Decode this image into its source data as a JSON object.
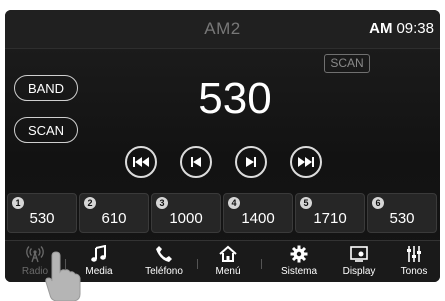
{
  "topbar": {
    "station": "AM2",
    "band": "AM",
    "time": "09:38"
  },
  "scan_indicator": "SCAN",
  "buttons": {
    "band": "BAND",
    "scan": "SCAN"
  },
  "frequency": "530",
  "controls": [
    "seek-back",
    "tune-down",
    "tune-up",
    "seek-forward"
  ],
  "presets": [
    {
      "num": "1",
      "value": "530"
    },
    {
      "num": "2",
      "value": "610"
    },
    {
      "num": "3",
      "value": "1000"
    },
    {
      "num": "4",
      "value": "1400"
    },
    {
      "num": "5",
      "value": "1710"
    },
    {
      "num": "6",
      "value": "530"
    }
  ],
  "nav": [
    {
      "label": "Radio",
      "icon": "radio-antenna-icon",
      "active": true
    },
    {
      "label": "Media",
      "icon": "music-note-icon"
    },
    {
      "label": "Teléfono",
      "icon": "phone-icon"
    },
    {
      "label": "Menú",
      "icon": "home-icon"
    },
    {
      "label": "Sistema",
      "icon": "gear-icon"
    },
    {
      "label": "Display",
      "icon": "display-icon"
    },
    {
      "label": "Tonos",
      "icon": "equalizer-icon"
    }
  ],
  "colors": {
    "background": "#141414",
    "text": "#ffffff",
    "inactive": "#777777"
  }
}
